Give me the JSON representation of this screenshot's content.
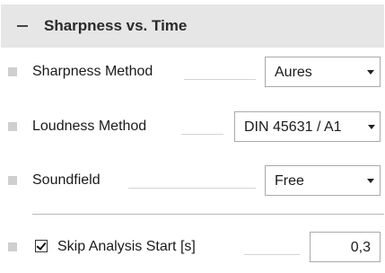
{
  "section": {
    "title": "Sharpness vs. Time"
  },
  "rows": [
    {
      "label": "Sharpness Method",
      "value": "Aures"
    },
    {
      "label": "Loudness Method",
      "value": "DIN 45631 / A1"
    },
    {
      "label": "Soundfield",
      "value": "Free"
    }
  ],
  "skip_analysis": {
    "label": "Skip Analysis Start [s]",
    "checked": true,
    "value": "0,3"
  },
  "icons": {
    "collapse": "minus-icon",
    "dropdown": "chevron-down-icon",
    "check": "checkmark-icon",
    "bullet": "square-bullet-icon"
  },
  "colors": {
    "header_bg": "#e6e6e6",
    "bullet": "#cfcfcf",
    "border": "#a9a9a9"
  }
}
